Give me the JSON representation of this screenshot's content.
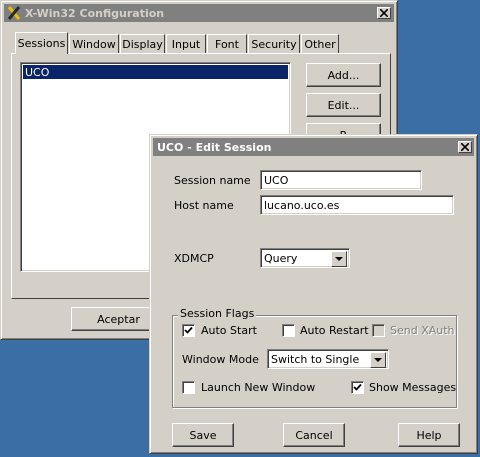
{
  "config_window": {
    "title": "X-Win32 Configuration",
    "tabs": [
      "Sessions",
      "Window",
      "Display",
      "Input",
      "Font",
      "Security",
      "Other"
    ],
    "sessions": [
      "UCO"
    ],
    "buttons": {
      "add": "Add...",
      "edit": "Edit...",
      "remove_partial": "R"
    },
    "accept_label": "Aceptar"
  },
  "edit_dialog": {
    "title": "UCO - Edit Session",
    "session_name_label": "Session name",
    "session_name_value": "UCO",
    "host_name_label": "Host name",
    "host_name_value": "lucano.uco.es",
    "xdmcp_label": "XDMCP",
    "xdmcp_value": "Query",
    "session_flags_label": "Session Flags",
    "auto_start_label": "Auto Start",
    "auto_start_checked": true,
    "auto_restart_label": "Auto Restart",
    "auto_restart_checked": false,
    "send_xauth_label": "Send XAuth",
    "send_xauth_enabled": false,
    "window_mode_label": "Window Mode",
    "window_mode_value": "Switch to Single",
    "launch_new_window_label": "Launch New Window",
    "launch_new_window_checked": false,
    "show_messages_label": "Show Messages",
    "show_messages_checked": true,
    "save_label": "Save",
    "cancel_label": "Cancel",
    "help_label": "Help"
  },
  "colors": {
    "desktop": "#3a6ea5",
    "face": "#d4d0c8",
    "selection": "#0a246a",
    "titlebar_inactive": "#808080"
  }
}
